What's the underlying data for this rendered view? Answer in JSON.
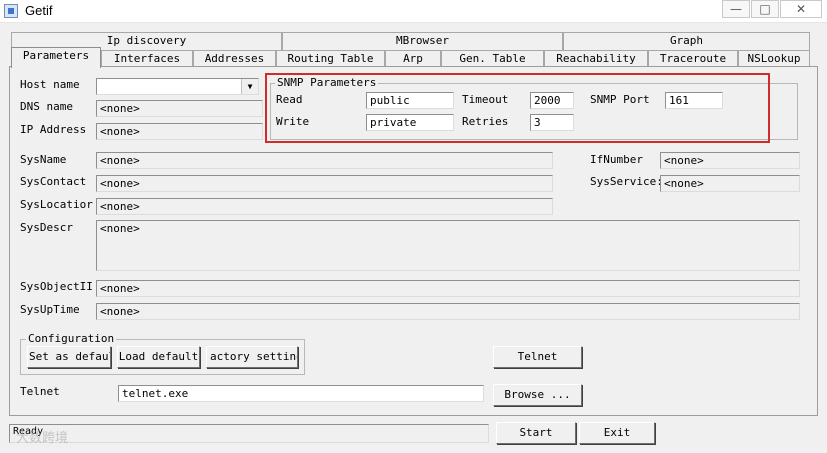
{
  "window": {
    "title": "Getif",
    "min_label": "—",
    "max_label": "□",
    "close_label": "✕"
  },
  "tabs": {
    "row1": [
      "Ip discovery",
      "MBrowser",
      "Graph"
    ],
    "row2": [
      "Parameters",
      "Interfaces",
      "Addresses",
      "Routing Table",
      "Arp",
      "Gen. Table",
      "Reachability",
      "Traceroute",
      "NSLookup"
    ],
    "active": "Parameters"
  },
  "params": {
    "host_name_label": "Host name",
    "host_name_value": "",
    "dns_name_label": "DNS name",
    "dns_name_value": "<none>",
    "ip_address_label": "IP Address",
    "ip_address_value": "<none>"
  },
  "snmp": {
    "group_title": "SNMP Parameters",
    "read_label": "Read",
    "read_value": "public",
    "write_label": "Write",
    "write_value": "private",
    "timeout_label": "Timeout",
    "timeout_value": "2000",
    "retries_label": "Retries",
    "retries_value": "3",
    "port_label": "SNMP Port",
    "port_value": "161"
  },
  "system": {
    "sysname_label": "SysName",
    "sysname_value": "<none>",
    "syscontact_label": "SysContact",
    "syscontact_value": "<none>",
    "syslocation_label": "SysLocatior",
    "syslocation_value": "<none>",
    "sysdescr_label": "SysDescr",
    "sysdescr_value": "<none>",
    "sysobjectid_label": "SysObjectII",
    "sysobjectid_value": "<none>",
    "sysuptime_label": "SysUpTime",
    "sysuptime_value": "<none>",
    "ifnumber_label": "IfNumber",
    "ifnumber_value": "<none>",
    "sysservices_label": "SysService:",
    "sysservices_value": "<none>"
  },
  "configuration": {
    "group_title": "Configuration",
    "set_default_label": "Set as defaul",
    "load_default_label": "Load default",
    "factory_settings_label": "actory setting"
  },
  "telnet": {
    "button_label": "Telnet",
    "path_label": "Telnet",
    "path_value": "telnet.exe",
    "browse_label": "Browse ..."
  },
  "footer": {
    "status_text": "Ready",
    "start_label": "Start",
    "exit_label": "Exit",
    "watermark_text": "大数跨境"
  },
  "colors": {
    "highlight_box": "#d22b2b",
    "window_bg": "#f0f0f0"
  }
}
